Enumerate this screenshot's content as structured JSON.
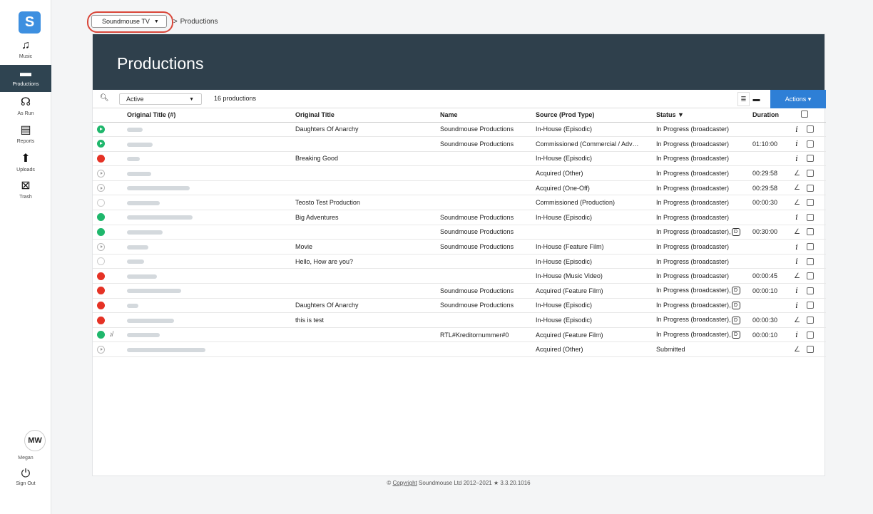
{
  "sidebar": {
    "logo": "S",
    "items": [
      {
        "label": "Music",
        "icon": "music-note-icon",
        "glyph": "♫"
      },
      {
        "label": "Productions",
        "icon": "clapperboard-icon",
        "glyph": "▬"
      },
      {
        "label": "As Run",
        "icon": "broadcast-icon",
        "glyph": "☊"
      },
      {
        "label": "Reports",
        "icon": "report-icon",
        "glyph": "▤"
      },
      {
        "label": "Uploads",
        "icon": "upload-arrow-icon",
        "glyph": "⬆"
      },
      {
        "label": "Trash",
        "icon": "trash-icon",
        "glyph": "⊠"
      }
    ],
    "user": {
      "initials": "MW",
      "name": "Megan"
    },
    "signout": {
      "label": "Sign Out",
      "glyph": "⏻"
    }
  },
  "breadcrumb": {
    "selector": "Soundmouse TV",
    "separator": ">",
    "current": "Productions"
  },
  "header": {
    "title": "Productions"
  },
  "toolbar": {
    "filter": "Active",
    "count": "16 productions",
    "actions": "Actions ▾"
  },
  "columns": [
    "Original Title (#)",
    "Original Title",
    "Name",
    "Source (Prod Type)",
    "Status ▼",
    "Duration"
  ],
  "rows": [
    {
      "ind": "play-green",
      "otitle": "Daughters Of Anarchy",
      "name": "Soundmouse Productions",
      "source": "In-House (Episodic)",
      "status": "In Progress (broadcaster)",
      "badge": "",
      "duration": "",
      "action": "info"
    },
    {
      "ind": "play-green",
      "otitle": "",
      "name": "Soundmouse Productions",
      "source": "Commissioned (Commercial / Adv…",
      "status": "In Progress (broadcaster)",
      "badge": "",
      "duration": "01:10:00",
      "action": "info"
    },
    {
      "ind": "red",
      "otitle": "Breaking Good",
      "name": "",
      "source": "In-House (Episodic)",
      "status": "In Progress (broadcaster)",
      "badge": "",
      "duration": "",
      "action": "info"
    },
    {
      "ind": "play-grey",
      "otitle": "",
      "name": "",
      "source": "Acquired (Other)",
      "status": "In Progress (broadcaster)",
      "badge": "",
      "duration": "00:29:58",
      "action": "edit"
    },
    {
      "ind": "play-grey",
      "otitle": "",
      "name": "",
      "source": "Acquired (One-Off)",
      "status": "In Progress (broadcaster)",
      "badge": "",
      "duration": "00:29:58",
      "action": "edit"
    },
    {
      "ind": "empty",
      "otitle": "Teosto Test Production",
      "name": "",
      "source": "Commissioned (Production)",
      "status": "In Progress (broadcaster)",
      "badge": "",
      "duration": "00:00:30",
      "action": "edit"
    },
    {
      "ind": "green",
      "otitle": "Big Adventures",
      "name": "Soundmouse Productions",
      "source": "In-House (Episodic)",
      "status": "In Progress (broadcaster)",
      "badge": "",
      "duration": "",
      "action": "info"
    },
    {
      "ind": "green",
      "otitle": "",
      "name": "Soundmouse Productions",
      "source": "",
      "status": "In Progress (broadcaster),",
      "badge": "D",
      "duration": "00:30:00",
      "action": "edit"
    },
    {
      "ind": "play-grey",
      "otitle": "Movie",
      "name": "Soundmouse Productions",
      "source": "In-House (Feature Film)",
      "status": "In Progress (broadcaster)",
      "badge": "",
      "duration": "",
      "action": "info"
    },
    {
      "ind": "empty",
      "otitle": "Hello, How are you?",
      "name": "",
      "source": "In-House (Episodic)",
      "status": "In Progress (broadcaster)",
      "badge": "",
      "duration": "",
      "action": "info"
    },
    {
      "ind": "red",
      "otitle": "",
      "name": "",
      "source": "In-House (Music Video)",
      "status": "In Progress (broadcaster)",
      "badge": "",
      "duration": "00:00:45",
      "action": "edit"
    },
    {
      "ind": "red",
      "otitle": "",
      "name": "Soundmouse Productions",
      "source": "Acquired (Feature Film)",
      "status": "In Progress (broadcaster),",
      "badge": "D",
      "duration": "00:00:10",
      "action": "info"
    },
    {
      "ind": "red",
      "otitle": "Daughters Of Anarchy",
      "name": "Soundmouse Productions",
      "source": "In-House (Episodic)",
      "status": "In Progress (broadcaster),",
      "badge": "D",
      "duration": "",
      "action": "info"
    },
    {
      "ind": "red",
      "otitle": "this is test",
      "name": "",
      "source": "In-House (Episodic)",
      "status": "In Progress (broadcaster),",
      "badge": "D",
      "duration": "00:00:30",
      "action": "edit"
    },
    {
      "ind": "green",
      "nomusic": true,
      "otitle": "",
      "name": "RTL#Kreditornummer#0",
      "source": "Acquired (Feature Film)",
      "status": "In Progress (broadcaster),",
      "badge": "D",
      "duration": "00:00:10",
      "action": "info"
    },
    {
      "ind": "play-grey",
      "otitle": "",
      "name": "",
      "source": "Acquired (Other)",
      "status": "Submitted",
      "badge": "",
      "duration": "",
      "action": "edit"
    }
  ],
  "footer": {
    "prefix": "©",
    "link": "Copyright",
    "text": "Soundmouse Ltd 2012–2021 ★ 3.3.20.1016"
  }
}
